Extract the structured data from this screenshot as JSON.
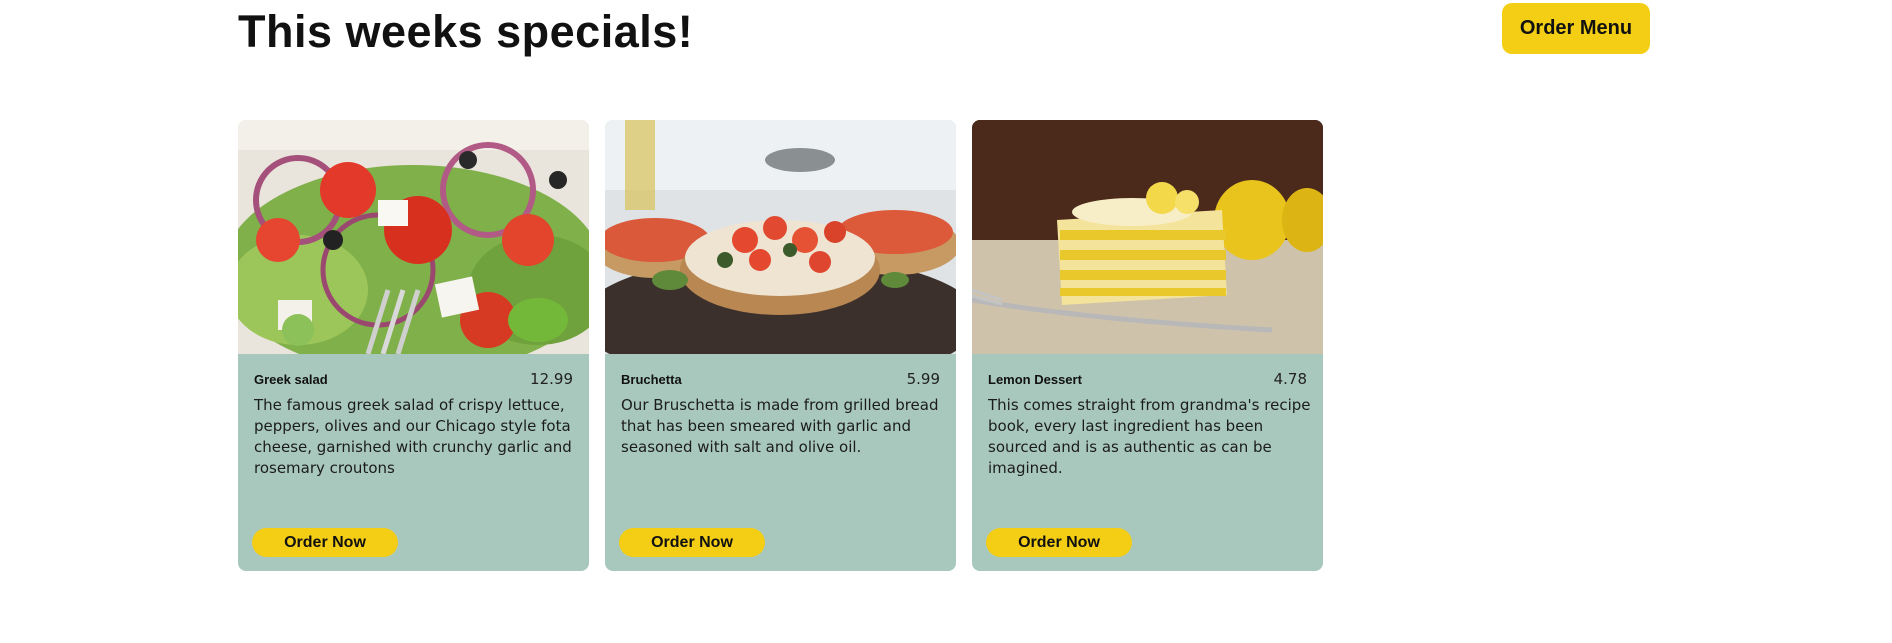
{
  "header": {
    "title": "This weeks specials!",
    "order_menu_label": "Order Menu"
  },
  "colors": {
    "accent": "#f4ce14",
    "card_background": "#a8c8be"
  },
  "specials": [
    {
      "name": "Greek salad",
      "price": "12.99",
      "description": "The famous greek salad of crispy lettuce, peppers, olives and our Chicago style fota cheese, garnished with crunchy garlic and rosemary croutons",
      "image": "greek-salad-photo",
      "button_label": "Order Now"
    },
    {
      "name": "Bruchetta",
      "price": "5.99",
      "description": "Our Bruschetta is made from grilled bread that has been smeared with garlic and seasoned with salt and olive oil.",
      "image": "bruschetta-photo",
      "button_label": "Order Now"
    },
    {
      "name": "Lemon Dessert",
      "price": "4.78",
      "description": "This comes straight from grandma's recipe book, every last ingredient has been sourced and is as authentic as can be imagined.",
      "image": "lemon-dessert-photo",
      "button_label": "Order Now"
    }
  ]
}
